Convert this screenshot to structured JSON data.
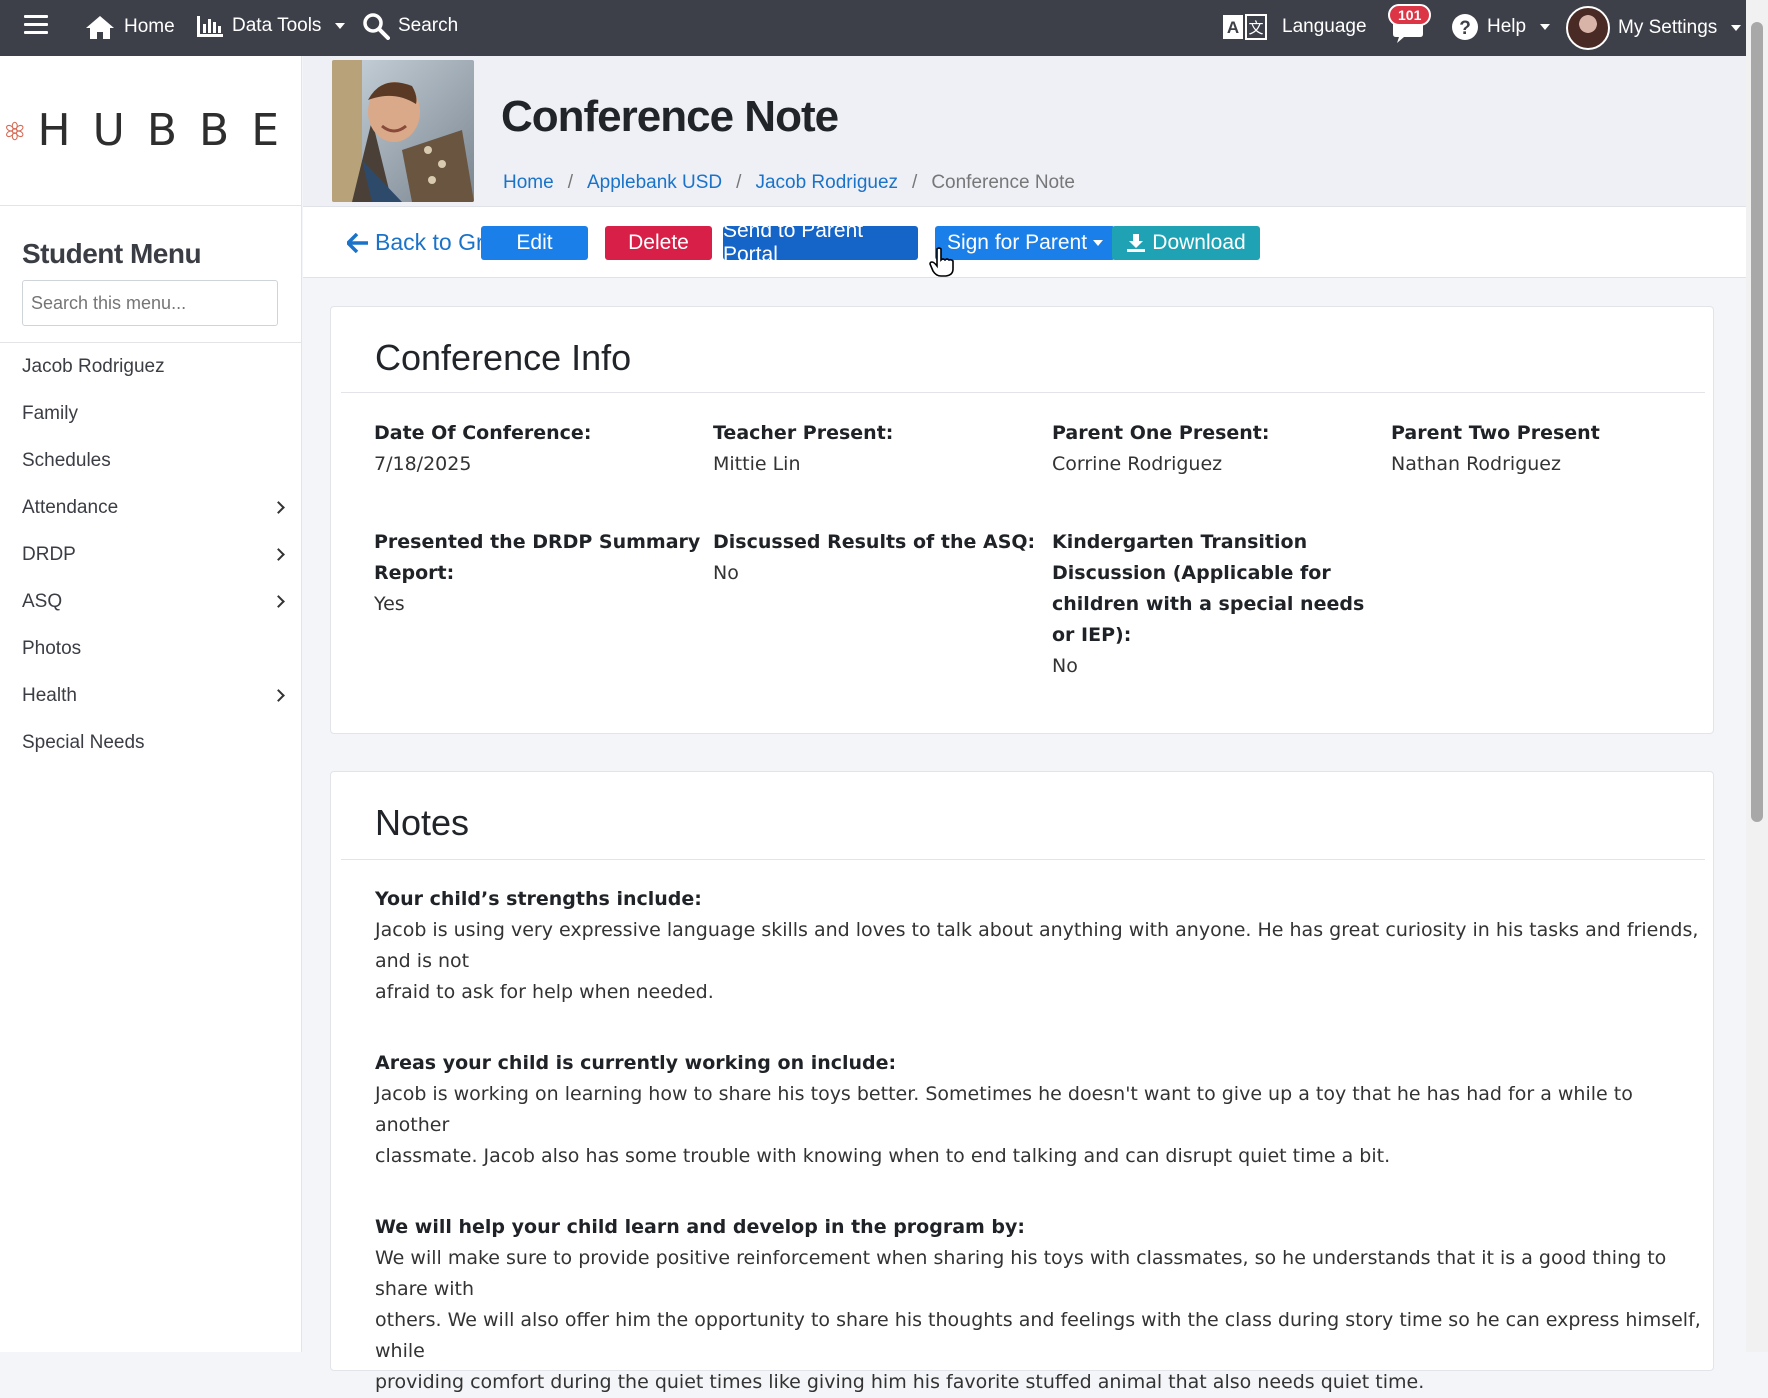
{
  "topbar": {
    "home": "Home",
    "data_tools": "Data Tools",
    "search": "Search",
    "language": "Language",
    "messages_count": "101",
    "help": "Help",
    "my_settings": "My Settings"
  },
  "sidebar": {
    "brand": "HUBBE",
    "menu_title": "Student Menu",
    "search_placeholder": "Search this menu...",
    "items": [
      {
        "label": "Jacob Rodriguez",
        "has_submenu": false
      },
      {
        "label": "Family",
        "has_submenu": false
      },
      {
        "label": "Schedules",
        "has_submenu": false
      },
      {
        "label": "Attendance",
        "has_submenu": true
      },
      {
        "label": "DRDP",
        "has_submenu": true
      },
      {
        "label": "ASQ",
        "has_submenu": true
      },
      {
        "label": "Photos",
        "has_submenu": false
      },
      {
        "label": "Health",
        "has_submenu": true
      },
      {
        "label": "Special Needs",
        "has_submenu": false
      }
    ]
  },
  "header": {
    "title": "Conference Note",
    "breadcrumb": [
      "Home",
      "Applebank USD",
      "Jacob Rodriguez",
      "Conference Note"
    ]
  },
  "actions": {
    "back": "Back to Grid",
    "edit": "Edit",
    "delete": "Delete",
    "send": "Send to Parent Portal",
    "sign": "Sign for Parent",
    "download": "Download"
  },
  "conference_info": {
    "title": "Conference Info",
    "date_label": "Date Of Conference:",
    "date_value": "7/18/2025",
    "teacher_label": "Teacher Present:",
    "teacher_value": "Mittie Lin",
    "parent_one_label": "Parent One Present:",
    "parent_one_value": "Corrine Rodriguez",
    "parent_two_label": "Parent Two Present",
    "parent_two_value": "Nathan Rodriguez",
    "drdp_label_1": "Presented the DRDP Summary",
    "drdp_label_2": "Report:",
    "drdp_value": "Yes",
    "asq_label": "Discussed Results of the ASQ:",
    "asq_value": "No",
    "kinder_label_1": "Kindergarten Transition",
    "kinder_label_2": "Discussion (Applicable for",
    "kinder_label_3": "children with a special needs",
    "kinder_label_4": "or IEP):",
    "kinder_value": "No"
  },
  "notes": {
    "title": "Notes",
    "strengths_label": "Your child’s strengths include:",
    "strengths_line1": "Jacob is using very expressive language skills and loves to talk about anything with anyone. He has great curiosity in his tasks and friends, and is not",
    "strengths_line2": "afraid to ask for help when needed.",
    "areas_label": "Areas your child is currently working on include:",
    "areas_line1": "Jacob is working on learning how to share his toys better. Sometimes he doesn't want to give up a toy that he has had for a while to another",
    "areas_line2": "classmate. Jacob also has some trouble with knowing when to end talking and can disrupt quiet time a bit.",
    "help_label": "We will help your child learn and develop in the program by:",
    "help_line1": "We will make sure to provide positive reinforcement when sharing his toys with classmates, so he understands that it is a good thing to share with",
    "help_line2": "others. We will also offer him the opportunity to share his thoughts and feelings with the class during story time so he can express himself, while",
    "help_line3": "providing comfort during the quiet times like giving him his favorite stuffed animal that also needs quiet time."
  },
  "colors": {
    "topbar": "#3d4049",
    "edit": "#1a7fe8",
    "delete": "#d81f48",
    "send": "#1565c8",
    "sign": "#1a7fe8",
    "download": "#1fa3b4",
    "link": "#1a73c9",
    "brand_flower": "#d66a55"
  }
}
